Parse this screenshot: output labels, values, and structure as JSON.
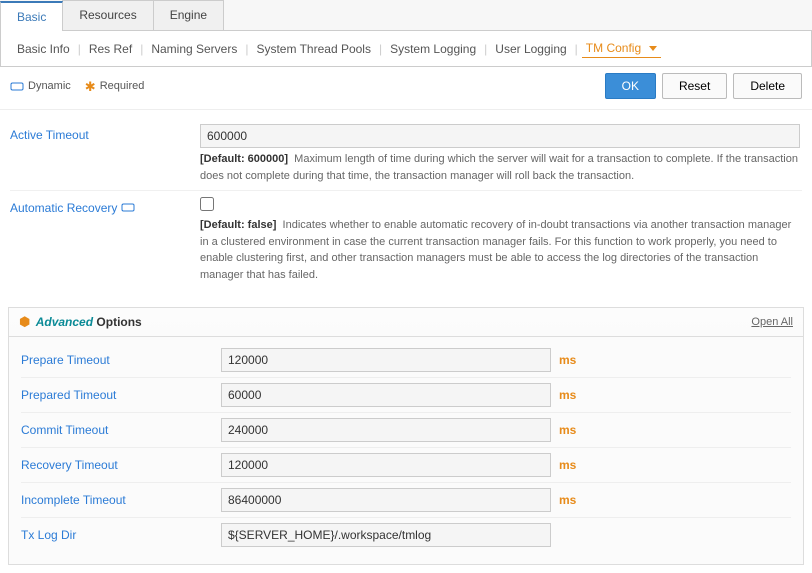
{
  "tabs": {
    "basic": "Basic",
    "resources": "Resources",
    "engine": "Engine"
  },
  "subtabs": {
    "basic_info": "Basic Info",
    "res_ref": "Res Ref",
    "naming_servers": "Naming Servers",
    "system_thread_pools": "System Thread Pools",
    "system_logging": "System Logging",
    "user_logging": "User Logging",
    "tm_config": "TM Config"
  },
  "legend": {
    "dynamic": "Dynamic",
    "required": "Required"
  },
  "buttons": {
    "ok": "OK",
    "reset": "Reset",
    "delete": "Delete"
  },
  "fields": {
    "active_timeout": {
      "label": "Active Timeout",
      "value": "600000",
      "default_label": "[Default: 600000]",
      "desc": "Maximum length of time during which the server will wait for a transaction to complete. If the transaction does not complete during that time, the transaction manager will roll back the transaction."
    },
    "automatic_recovery": {
      "label": "Automatic Recovery",
      "default_label": "[Default: false]",
      "desc": "Indicates whether to enable automatic recovery of in-doubt transactions via another transaction manager in a clustered environment in case the current transaction manager fails. For this function to work properly, you need to enable clustering first, and other transaction managers must be able to access the log directories of the transaction manager that has failed."
    }
  },
  "advanced": {
    "title1": "Advanced",
    "title2": "Options",
    "open_all": "Open All",
    "unit": "ms",
    "rows": {
      "prepare_timeout": {
        "label": "Prepare Timeout",
        "value": "120000",
        "unit": true
      },
      "prepared_timeout": {
        "label": "Prepared Timeout",
        "value": "60000",
        "unit": true
      },
      "commit_timeout": {
        "label": "Commit Timeout",
        "value": "240000",
        "unit": true
      },
      "recovery_timeout": {
        "label": "Recovery Timeout",
        "value": "120000",
        "unit": true
      },
      "incomplete_timeout": {
        "label": "Incomplete Timeout",
        "value": "86400000",
        "unit": true
      },
      "tx_log_dir": {
        "label": "Tx Log Dir",
        "value": "${SERVER_HOME}/.workspace/tmlog",
        "unit": false
      }
    }
  }
}
